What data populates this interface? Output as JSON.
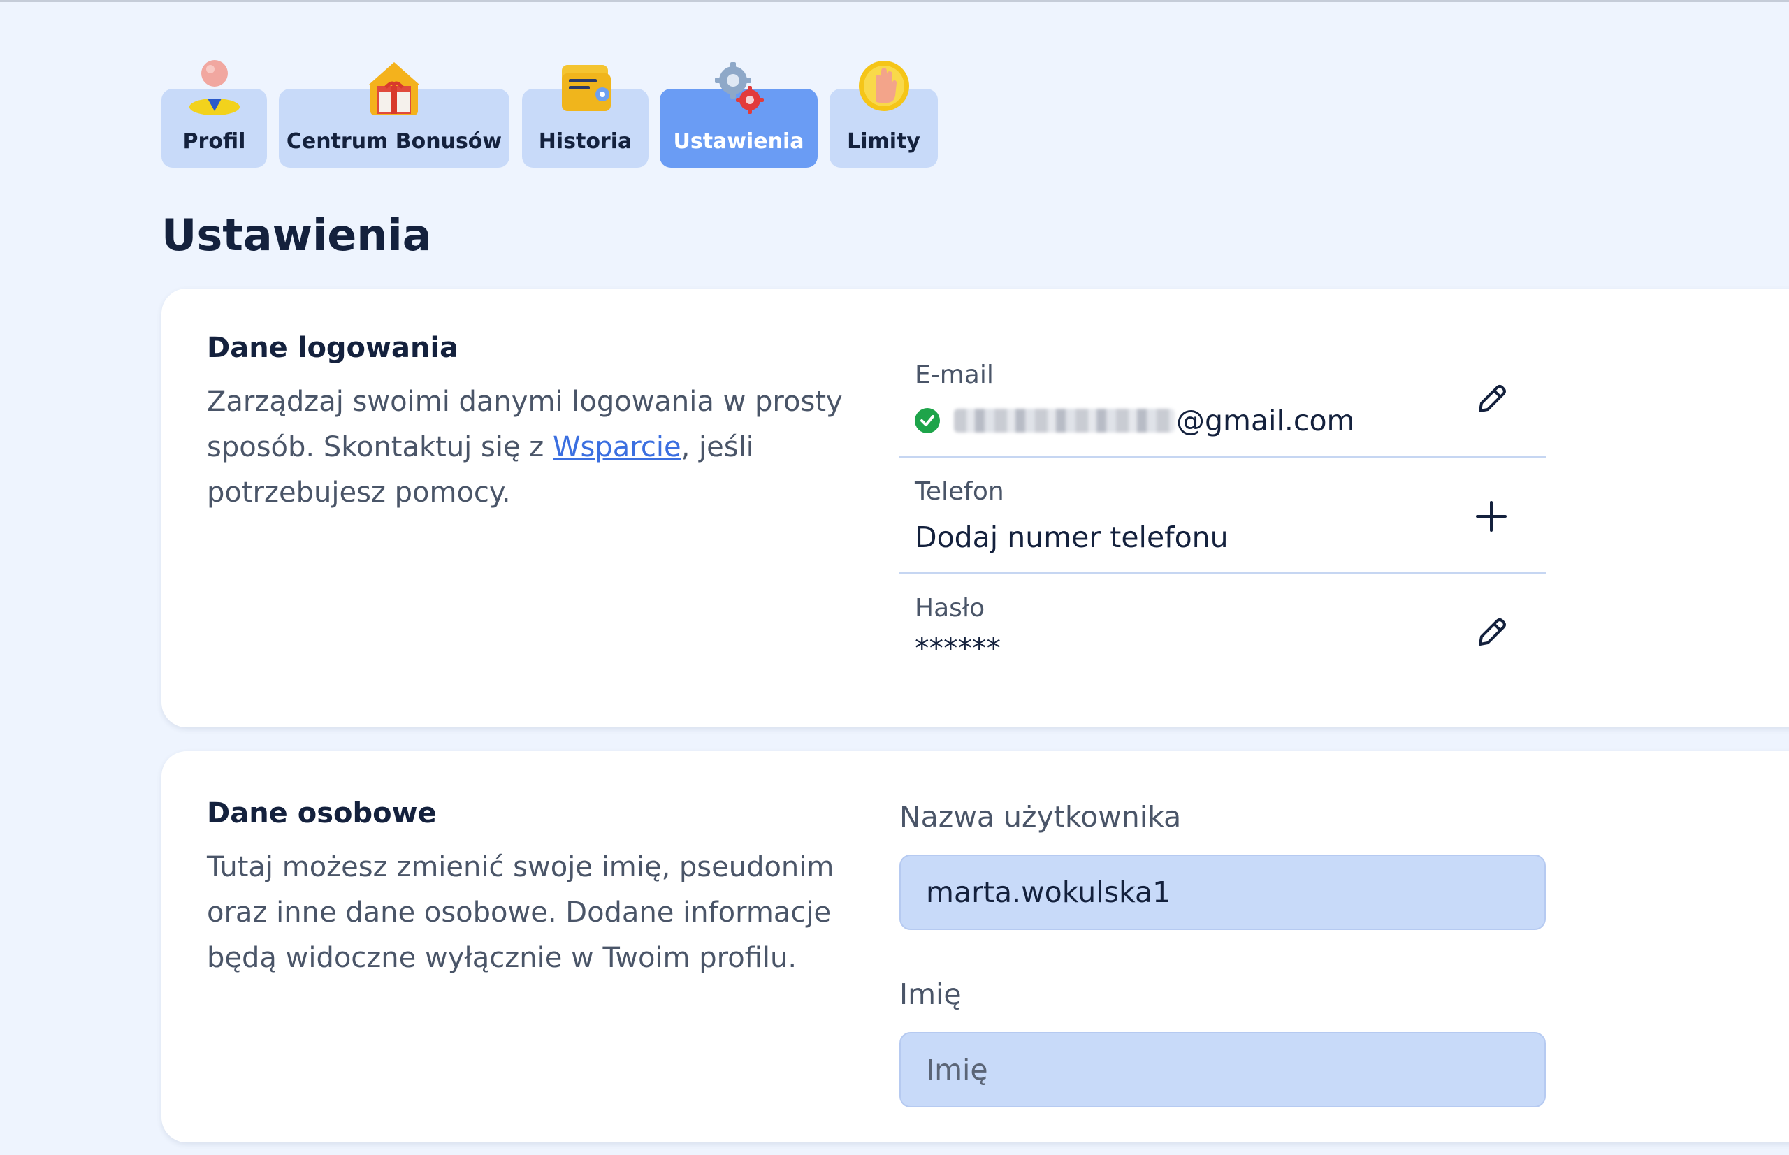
{
  "tabs": [
    {
      "label": "Profil",
      "icon": "user-avatar-icon"
    },
    {
      "label": "Centrum Bonusów",
      "icon": "gift-icon"
    },
    {
      "label": "Historia",
      "icon": "wallet-icon"
    },
    {
      "label": "Ustawienia",
      "icon": "gears-icon",
      "active": true
    },
    {
      "label": "Limity",
      "icon": "hand-stop-icon"
    }
  ],
  "page": {
    "title": "Ustawienia"
  },
  "login": {
    "title": "Dane logowania",
    "desc_before": "Zarządzaj swoimi danymi logowania w prosty sposób. Skontaktuj się z ",
    "desc_link": "Wsparcie",
    "desc_after": ", jeśli potrzebujesz pomocy.",
    "email_label": "E-mail",
    "email_domain": "@gmail.com",
    "phone_label": "Telefon",
    "phone_value": "Dodaj numer telefonu",
    "password_label": "Hasło",
    "password_value": "******"
  },
  "personal": {
    "title": "Dane osobowe",
    "desc": "Tutaj możesz zmienić swoje imię, pseudonim oraz inne dane osobowe. Dodane informacje będą widoczne wyłącznie w Twoim profilu.",
    "username_label": "Nazwa użytkownika",
    "username_value": "marta.wokulska1",
    "firstname_label": "Imię",
    "firstname_placeholder": "Imię"
  },
  "colors": {
    "background": "#eef4fe",
    "tab": "#c8daf9",
    "tab_active": "#6a9cf4",
    "link": "#3b6fe0",
    "verified": "#1ea44a"
  }
}
